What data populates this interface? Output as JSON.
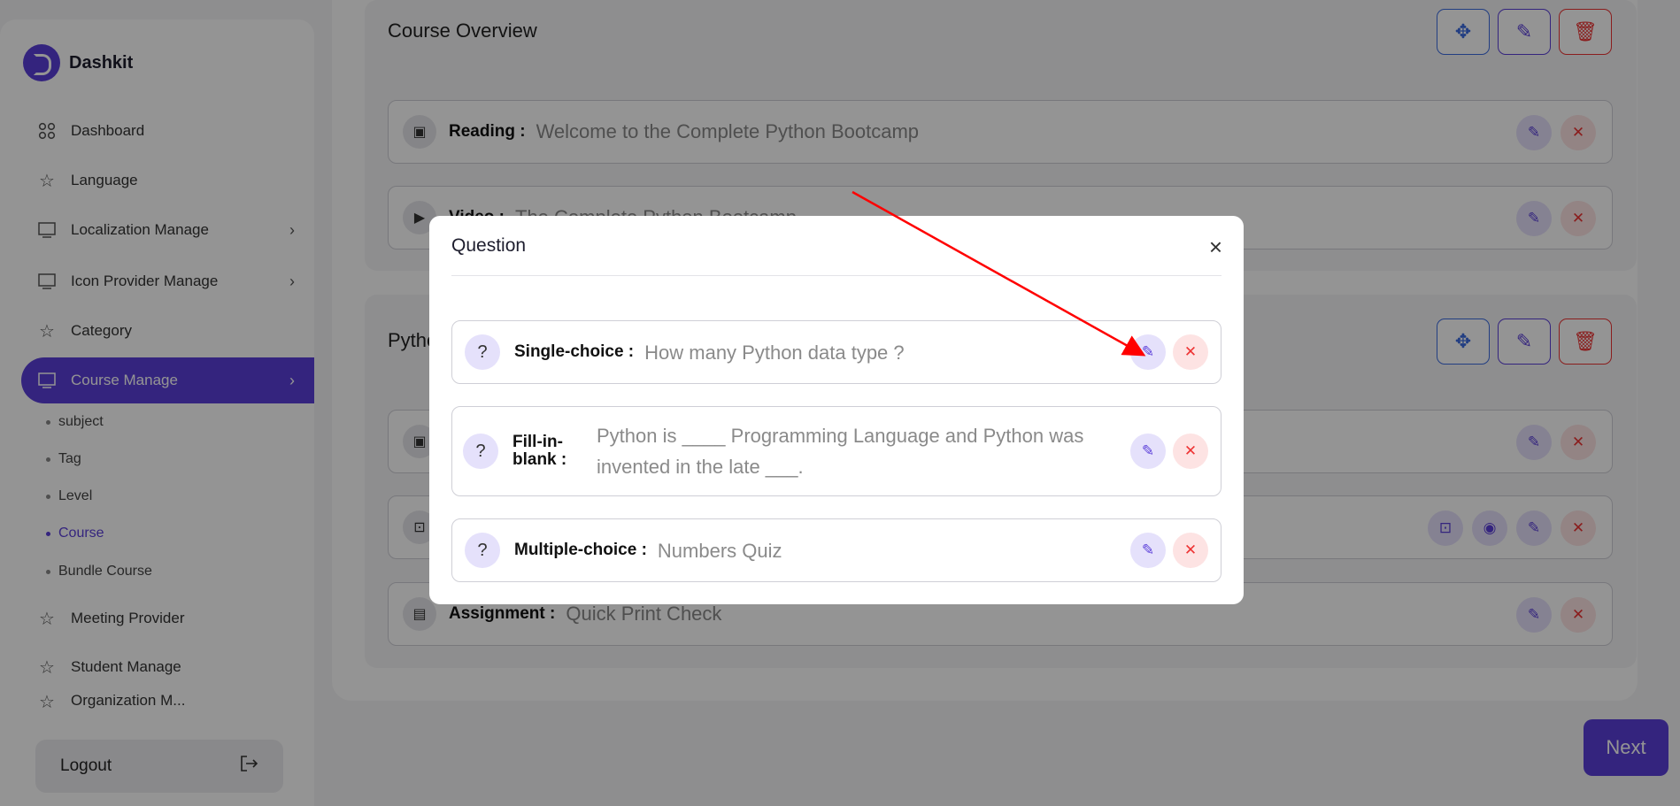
{
  "sidebar": {
    "brand": "Dashkit",
    "items": [
      {
        "label": "Dashboard"
      },
      {
        "label": "Language"
      },
      {
        "label": "Localization Manage"
      },
      {
        "label": "Icon Provider Manage"
      },
      {
        "label": "Category"
      },
      {
        "label": "Course Manage"
      },
      {
        "label": "Meeting Provider"
      },
      {
        "label": "Student Manage"
      },
      {
        "label": "Organization M..."
      }
    ],
    "sub_items": [
      {
        "label": "subject"
      },
      {
        "label": "Tag"
      },
      {
        "label": "Level"
      },
      {
        "label": "Course"
      },
      {
        "label": "Bundle Course"
      }
    ],
    "logout": "Logout"
  },
  "main": {
    "section1": {
      "title": "Course Overview",
      "rows": [
        {
          "label": "Reading :",
          "value": "Welcome to the Complete Python Bootcamp"
        },
        {
          "label": "Video :",
          "value": "The Complete Python Bootcamp"
        }
      ]
    },
    "section2": {
      "title": "Pytho",
      "rows": [
        {
          "label": "",
          "value": ""
        },
        {
          "label": "",
          "value": ""
        },
        {
          "label": "Assignment :",
          "value": "Quick Print Check"
        }
      ]
    },
    "next_label": "Next"
  },
  "modal": {
    "title": "Question",
    "close": "×",
    "questions": [
      {
        "type": "Single-choice :",
        "text": "How many Python data type ?"
      },
      {
        "type_line1": "Fill-in-",
        "type_line2": "blank :",
        "text": "Python is ____ Programming Language and Python was invented in the late ___."
      },
      {
        "type": "Multiple-choice :",
        "text": "Numbers Quiz"
      }
    ]
  },
  "colors": {
    "accent": "#5b3fd9",
    "danger": "#ee3333",
    "annotation_arrow": "#ff0000"
  }
}
